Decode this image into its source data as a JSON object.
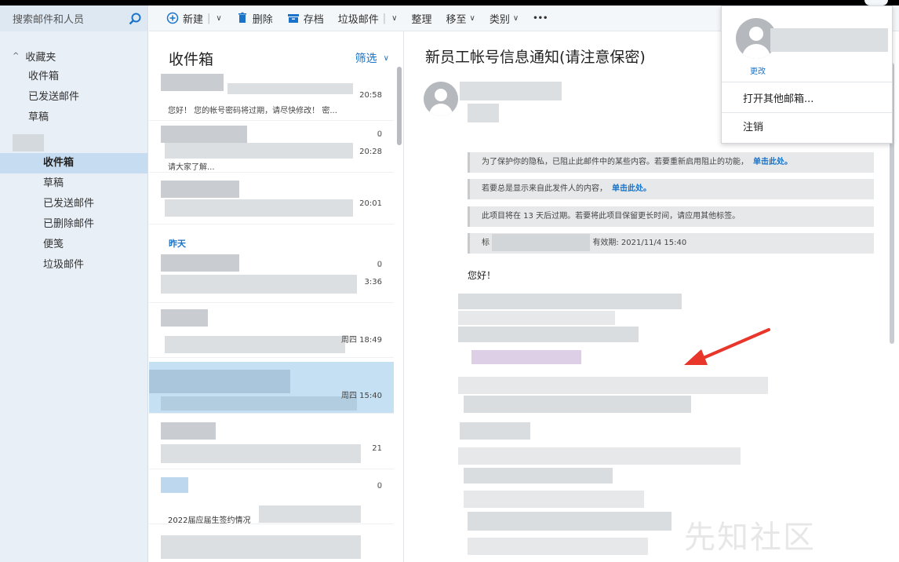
{
  "search": {
    "placeholder": "搜索邮件和人员"
  },
  "nav": {
    "favorites_label": "收藏夹",
    "favorites": [
      "收件箱",
      "已发送邮件",
      "草稿"
    ],
    "folders": [
      "收件箱",
      "草稿",
      "已发送邮件",
      "已删除邮件",
      "便笺",
      "垃圾邮件"
    ]
  },
  "toolbar": {
    "new": "新建",
    "delete": "删除",
    "archive": "存档",
    "junk": "垃圾邮件",
    "sweep": "整理",
    "move": "移至",
    "category": "类别",
    "more": "•••"
  },
  "list": {
    "title": "收件箱",
    "filter": "筛选",
    "yesterday": "昨天",
    "messages": [
      {
        "time": "20:58",
        "preview": "您好！  您的帐号密码将过期，请尽快修改！  密..."
      },
      {
        "time": "20:28",
        "preview": "请大家了解..."
      },
      {
        "time": "20:01",
        "preview": ""
      },
      {
        "time": "3:36",
        "preview": ""
      },
      {
        "time": "周四 18:49",
        "preview": ""
      },
      {
        "time": "周四 15:40",
        "preview": ""
      },
      {
        "time": "21",
        "preview": ""
      },
      {
        "time": "",
        "subject": "2022届应届生签约情况"
      }
    ]
  },
  "reading": {
    "title": "新员工帐号信息通知(请注意保密)",
    "notices": [
      {
        "text": "为了保护你的隐私，已阻止此邮件中的某些内容。若要重新启用阻止的功能，",
        "link": "单击此处。"
      },
      {
        "text": "若要总是显示来自此发件人的内容，",
        "link": "单击此处。"
      },
      {
        "text": "此项目将在 13 天后过期。若要将此项目保留更长时间，请应用其他标签。",
        "link": ""
      },
      {
        "text_start": "标",
        "text_end": "有效期: 2021/11/4 15:40"
      }
    ],
    "greeting": "您好！"
  },
  "popup": {
    "change": "更改",
    "open_other": "打开其他邮箱...",
    "sign_out": "注销"
  },
  "watermark": "先知社区",
  "colors": {
    "accent": "#1a73c8",
    "selected": "#c5dff3",
    "nav_bg": "#e8eff6",
    "arrow": "#e8362b"
  }
}
